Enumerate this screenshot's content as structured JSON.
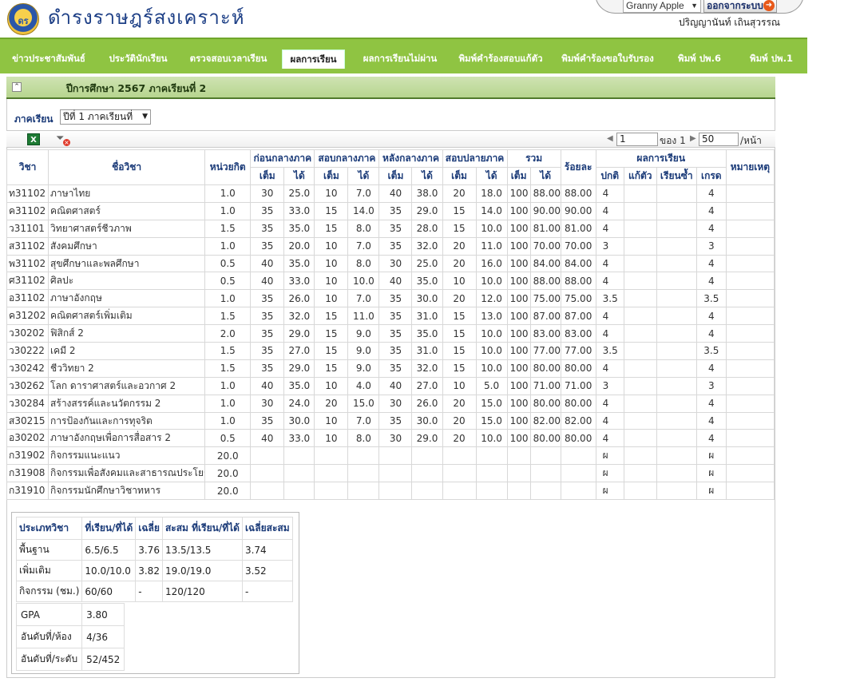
{
  "header": {
    "site_title": "ดำรงราษฎร์สงเคราะห์",
    "user_select": "Granny Apple",
    "logout_label": "ออกจากระบบ",
    "user_name": "ปริญญานันท์  เถินสุวรรณ"
  },
  "nav": {
    "tabs": [
      {
        "label": "ข่าวประชาสัมพันธ์",
        "active": false
      },
      {
        "label": "ประวัตินักเรียน",
        "active": false
      },
      {
        "label": "ตรวจสอบเวลาเรียน",
        "active": false
      },
      {
        "label": "ผลการเรียน",
        "active": true
      },
      {
        "label": "ผลการเรียนไม่ผ่าน",
        "active": false
      },
      {
        "label": "พิมพ์คำร้องสอบแก้ตัว",
        "active": false
      },
      {
        "label": "พิมพ์คำร้องขอใบรับรอง",
        "active": false
      },
      {
        "label": "พิมพ์ ปพ.6",
        "active": false
      },
      {
        "label": "พิมพ์ ปพ.1",
        "active": false
      }
    ]
  },
  "year_bar": {
    "label": "ปีการศึกษา  2567  ภาคเรียนที่  2"
  },
  "term": {
    "label": "ภาคเรียน",
    "selected": "ปีที่  1  ภาคเรียนที่"
  },
  "pager": {
    "page": "1",
    "of_label": "ของ  1",
    "size": "50",
    "per_label": "/หน้า"
  },
  "table": {
    "headers": {
      "code": "วิชา",
      "name": "ชื่อวิชา",
      "credit": "หน่วยกิต",
      "before_mid": "ก่อนกลางภาค",
      "mid": "สอบกลางภาค",
      "after_mid": "หลังกลางภาค",
      "final": "สอบปลายภาค",
      "total": "รวม",
      "percent": "ร้อยละ",
      "result": "ผลการเรียน",
      "remark": "หมายเหตุ",
      "full": "เต็ม",
      "got": "ได้",
      "normal": "ปกติ",
      "retest": "แก้ตัว",
      "repeat": "เรียนซ้ำ",
      "grade": "เกรด"
    },
    "rows": [
      [
        "ท31102",
        "ภาษาไทย",
        "1.0",
        "30",
        "25.0",
        "10",
        "7.0",
        "40",
        "38.0",
        "20",
        "18.0",
        "100",
        "88.00",
        "88.00",
        "4",
        "",
        "",
        "4",
        ""
      ],
      [
        "ค31102",
        "คณิตศาสตร์",
        "1.0",
        "35",
        "33.0",
        "15",
        "14.0",
        "35",
        "29.0",
        "15",
        "14.0",
        "100",
        "90.00",
        "90.00",
        "4",
        "",
        "",
        "4",
        ""
      ],
      [
        "ว31101",
        "วิทยาศาสตร์ชีวภาพ",
        "1.5",
        "35",
        "35.0",
        "15",
        "8.0",
        "35",
        "28.0",
        "15",
        "10.0",
        "100",
        "81.00",
        "81.00",
        "4",
        "",
        "",
        "4",
        ""
      ],
      [
        "ส31102",
        "สังคมศึกษา",
        "1.0",
        "35",
        "20.0",
        "10",
        "7.0",
        "35",
        "32.0",
        "20",
        "11.0",
        "100",
        "70.00",
        "70.00",
        "3",
        "",
        "",
        "3",
        ""
      ],
      [
        "พ31102",
        "สุขศึกษาและพลศึกษา",
        "0.5",
        "40",
        "35.0",
        "10",
        "8.0",
        "30",
        "25.0",
        "20",
        "16.0",
        "100",
        "84.00",
        "84.00",
        "4",
        "",
        "",
        "4",
        ""
      ],
      [
        "ศ31102",
        "ศิลปะ",
        "0.5",
        "40",
        "33.0",
        "10",
        "10.0",
        "40",
        "35.0",
        "10",
        "10.0",
        "100",
        "88.00",
        "88.00",
        "4",
        "",
        "",
        "4",
        ""
      ],
      [
        "อ31102",
        "ภาษาอังกฤษ",
        "1.0",
        "35",
        "26.0",
        "10",
        "7.0",
        "35",
        "30.0",
        "20",
        "12.0",
        "100",
        "75.00",
        "75.00",
        "3.5",
        "",
        "",
        "3.5",
        ""
      ],
      [
        "ค31202",
        "คณิตศาสตร์เพิ่มเติม",
        "1.5",
        "35",
        "32.0",
        "15",
        "11.0",
        "35",
        "31.0",
        "15",
        "13.0",
        "100",
        "87.00",
        "87.00",
        "4",
        "",
        "",
        "4",
        ""
      ],
      [
        "ว30202",
        "ฟิสิกส์  2",
        "2.0",
        "35",
        "29.0",
        "15",
        "9.0",
        "35",
        "35.0",
        "15",
        "10.0",
        "100",
        "83.00",
        "83.00",
        "4",
        "",
        "",
        "4",
        ""
      ],
      [
        "ว30222",
        "เคมี  2",
        "1.5",
        "35",
        "27.0",
        "15",
        "9.0",
        "35",
        "31.0",
        "15",
        "10.0",
        "100",
        "77.00",
        "77.00",
        "3.5",
        "",
        "",
        "3.5",
        ""
      ],
      [
        "ว30242",
        "ชีววิทยา  2",
        "1.5",
        "35",
        "29.0",
        "15",
        "9.0",
        "35",
        "32.0",
        "15",
        "10.0",
        "100",
        "80.00",
        "80.00",
        "4",
        "",
        "",
        "4",
        ""
      ],
      [
        "ว30262",
        "โลก  ดาราศาสตร์และอวกาศ  2",
        "1.0",
        "40",
        "35.0",
        "10",
        "4.0",
        "40",
        "27.0",
        "10",
        "5.0",
        "100",
        "71.00",
        "71.00",
        "3",
        "",
        "",
        "3",
        ""
      ],
      [
        "ว30284",
        "สร้างสรรค์และนวัตกรรม  2",
        "1.0",
        "30",
        "24.0",
        "20",
        "15.0",
        "30",
        "26.0",
        "20",
        "15.0",
        "100",
        "80.00",
        "80.00",
        "4",
        "",
        "",
        "4",
        ""
      ],
      [
        "ส30215",
        "การป้องกันและการทุจริต",
        "1.0",
        "35",
        "30.0",
        "10",
        "7.0",
        "35",
        "30.0",
        "20",
        "15.0",
        "100",
        "82.00",
        "82.00",
        "4",
        "",
        "",
        "4",
        ""
      ],
      [
        "อ30202",
        "ภาษาอังกฤษเพื่อการสื่อสาร  2",
        "0.5",
        "40",
        "33.0",
        "10",
        "8.0",
        "30",
        "29.0",
        "20",
        "10.0",
        "100",
        "80.00",
        "80.00",
        "4",
        "",
        "",
        "4",
        ""
      ],
      [
        "ก31902",
        "กิจกรรมแนะแนว",
        "20.0",
        "",
        "",
        "",
        "",
        "",
        "",
        "",
        "",
        "",
        "",
        "",
        "ผ",
        "",
        "",
        "ผ",
        ""
      ],
      [
        "ก31908",
        "กิจกรรมเพื่อสังคมและสาธารณประโยชน์",
        "20.0",
        "",
        "",
        "",
        "",
        "",
        "",
        "",
        "",
        "",
        "",
        "",
        "ผ",
        "",
        "",
        "ผ",
        ""
      ],
      [
        "ก31910",
        "กิจกรรมนักศึกษาวิชาทหาร",
        "20.0",
        "",
        "",
        "",
        "",
        "",
        "",
        "",
        "",
        "",
        "",
        "",
        "ผ",
        "",
        "",
        "ผ",
        ""
      ]
    ]
  },
  "summary": {
    "headers": [
      "ประเภทวิชา",
      "ที่เรียน/ที่ได้",
      "เฉลี่ย",
      "สะสม  ที่เรียน/ที่ได้",
      "เฉลี่ยสะสม"
    ],
    "rows": [
      [
        "พื้นฐาน",
        "6.5/6.5",
        "3.76",
        "13.5/13.5",
        "3.74"
      ],
      [
        "เพิ่มเติม",
        "10.0/10.0",
        "3.82",
        "19.0/19.0",
        "3.52"
      ],
      [
        "กิจกรรม  (ชม.)",
        "60/60",
        "-",
        "120/120",
        "-"
      ]
    ],
    "gpa_rows": [
      [
        "GPA",
        "3.80"
      ],
      [
        "อันดับที่/ห้อง",
        "4/36"
      ],
      [
        "อันดับที่/ระดับ",
        "52/452"
      ]
    ]
  },
  "colors": {
    "nav_green": "#8fc442",
    "bar_green": "#b7d58f",
    "header_blue": "#1a3a78"
  },
  "icons": [
    "school-logo",
    "logout-arrow-icon",
    "collapse-icon",
    "excel-export-icon",
    "clear-filter-icon",
    "pager-prev-icon",
    "pager-next-icon"
  ]
}
